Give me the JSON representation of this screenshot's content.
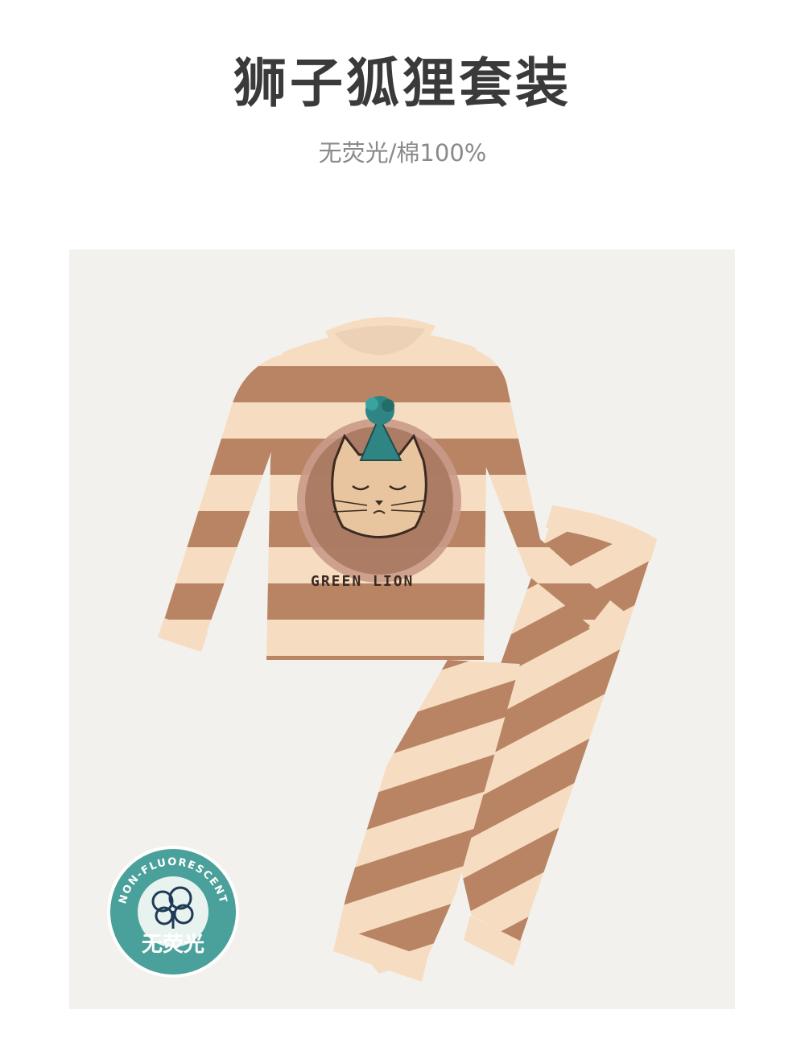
{
  "header": {
    "title": "狮子狐狸套装",
    "subtitle": "无荧光/棉100%"
  },
  "product": {
    "print_text": "GREEN LION",
    "colors": {
      "stripe_light": "#f6dcc1",
      "stripe_dark": "#b98463",
      "hat": "#2e8584",
      "background": "#f2f1ed"
    }
  },
  "badge": {
    "arc_text": "NON-FLUORESCENT",
    "label": "无荧光",
    "icon": "cotton-icon",
    "color": "#3f9a93"
  }
}
